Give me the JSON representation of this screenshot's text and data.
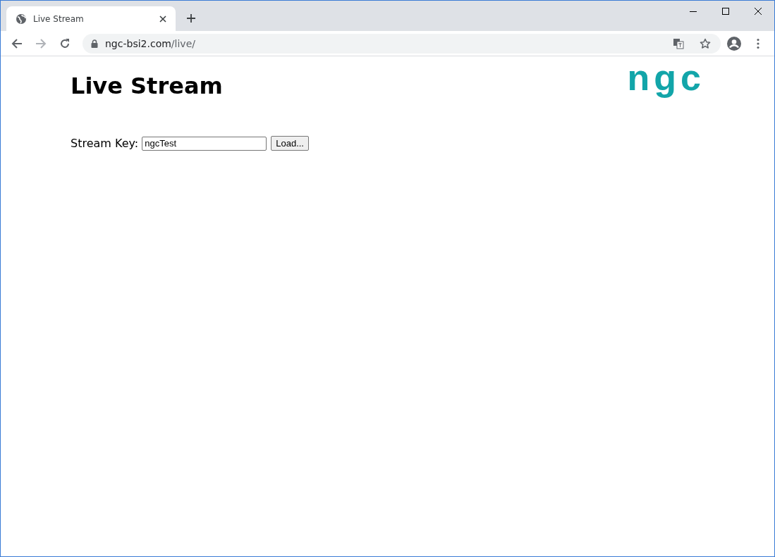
{
  "browser": {
    "tabs": [
      {
        "title": "Live Stream",
        "selected": true
      }
    ],
    "address": {
      "host": "ngc-bsi2.com",
      "path": "/live/"
    }
  },
  "page": {
    "title": "Live Stream",
    "logo_text": "ngc",
    "form": {
      "label": "Stream Key:",
      "value": "ngcTest",
      "button": "Load..."
    }
  }
}
